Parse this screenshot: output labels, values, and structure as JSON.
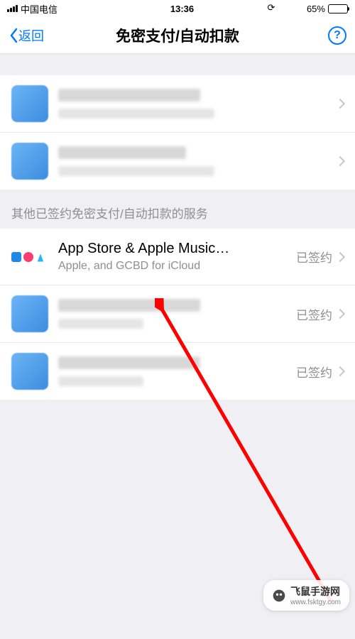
{
  "status_bar": {
    "carrier": "中国电信",
    "time": "13:36",
    "battery_pct": "65%"
  },
  "nav": {
    "back_label": "返回",
    "title": "免密支付/自动扣款"
  },
  "section_header": "其他已签约免密支付/自动扣款的服务",
  "items": [
    {
      "title": "App Store & Apple Music…",
      "subtitle": "Apple, and GCBD for iCloud",
      "status": "已签约"
    }
  ],
  "signed_label": "已签约",
  "watermark": {
    "brand": "飞鼠手游网",
    "url": "www.fsktgy.com"
  }
}
